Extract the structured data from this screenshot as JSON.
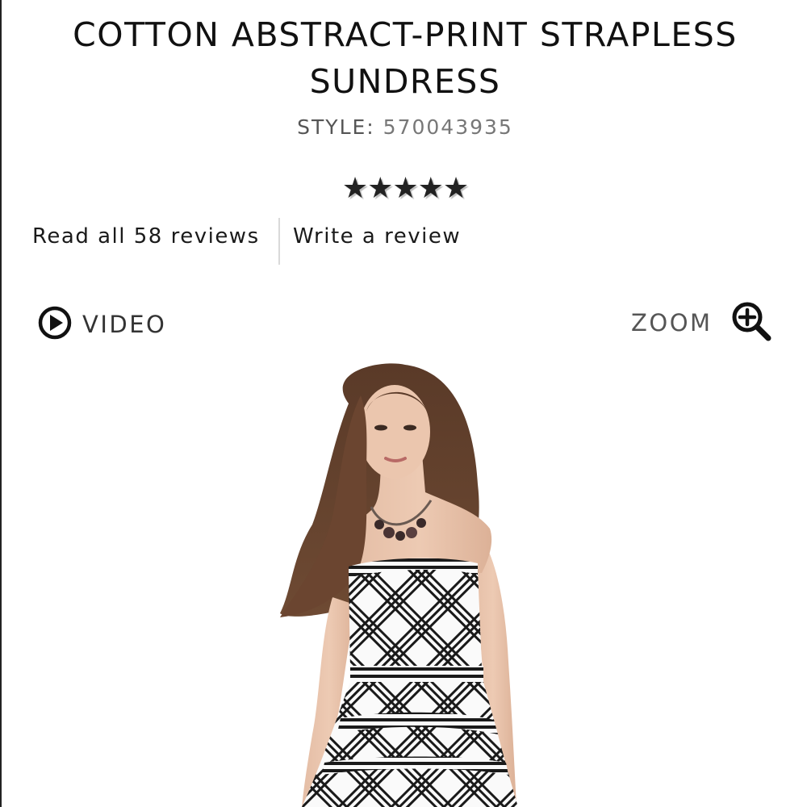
{
  "product": {
    "title": "COTTON ABSTRACT-PRINT STRAPLESS SUNDRESS",
    "style_label": "STYLE:",
    "style_number": "570043935",
    "rating_stars": "★★★★★",
    "rating": 5
  },
  "reviews": {
    "read_all_label": "Read all 58 reviews",
    "write_label": "Write a review"
  },
  "media": {
    "video_label": "VIDEO",
    "zoom_label": "ZOOM"
  }
}
